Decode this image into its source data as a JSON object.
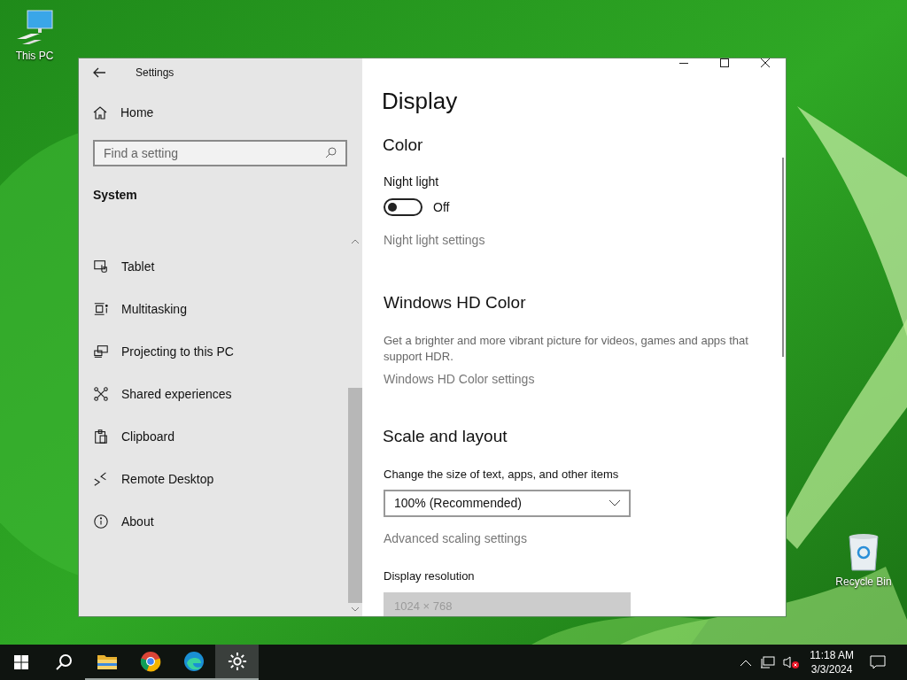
{
  "desktop_icons": [
    {
      "kind": "computer",
      "label": "This PC"
    },
    {
      "kind": "bin",
      "label": "Recycle Bin"
    }
  ],
  "window": {
    "title": "Settings"
  },
  "sidebar": {
    "home": "Home",
    "search": {
      "placeholder": "Find a setting"
    },
    "section": "System",
    "items": [
      {
        "kind": "tablet",
        "label": "Tablet",
        "selected": false
      },
      {
        "kind": "multitasking",
        "label": "Multitasking",
        "selected": false
      },
      {
        "kind": "projecting",
        "label": "Projecting to this PC",
        "selected": false
      },
      {
        "kind": "shared",
        "label": "Shared experiences",
        "selected": false
      },
      {
        "kind": "clipboard",
        "label": "Clipboard",
        "selected": false
      },
      {
        "kind": "remote",
        "label": "Remote Desktop",
        "selected": false
      },
      {
        "kind": "about",
        "label": "About",
        "selected": false
      }
    ]
  },
  "page": {
    "title": "Display",
    "color": {
      "heading": "Color",
      "night_light": {
        "label": "Night light",
        "on": false,
        "state": "Off"
      },
      "link": "Night light settings"
    },
    "hdr": {
      "heading": "Windows HD Color",
      "description": "Get a brighter and more vibrant picture for videos, games and apps that support HDR.",
      "link": "Windows HD Color settings"
    },
    "scale": {
      "heading": "Scale and layout",
      "size_label": "Change the size of text, apps, and other items",
      "size_value": "100% (Recommended)",
      "advanced_link": "Advanced scaling settings",
      "resolution_label": "Display resolution",
      "resolution_value": "1024 × 768",
      "resolution_disabled": true
    }
  },
  "taskbar": {
    "apps": [
      {
        "kind": "explorer",
        "running": true,
        "active": false
      },
      {
        "kind": "chrome",
        "running": true,
        "active": false
      },
      {
        "kind": "edge",
        "running": true,
        "active": false
      },
      {
        "kind": "settings",
        "running": true,
        "active": true
      }
    ],
    "time": "11:18 AM",
    "date": "3/3/2024"
  }
}
